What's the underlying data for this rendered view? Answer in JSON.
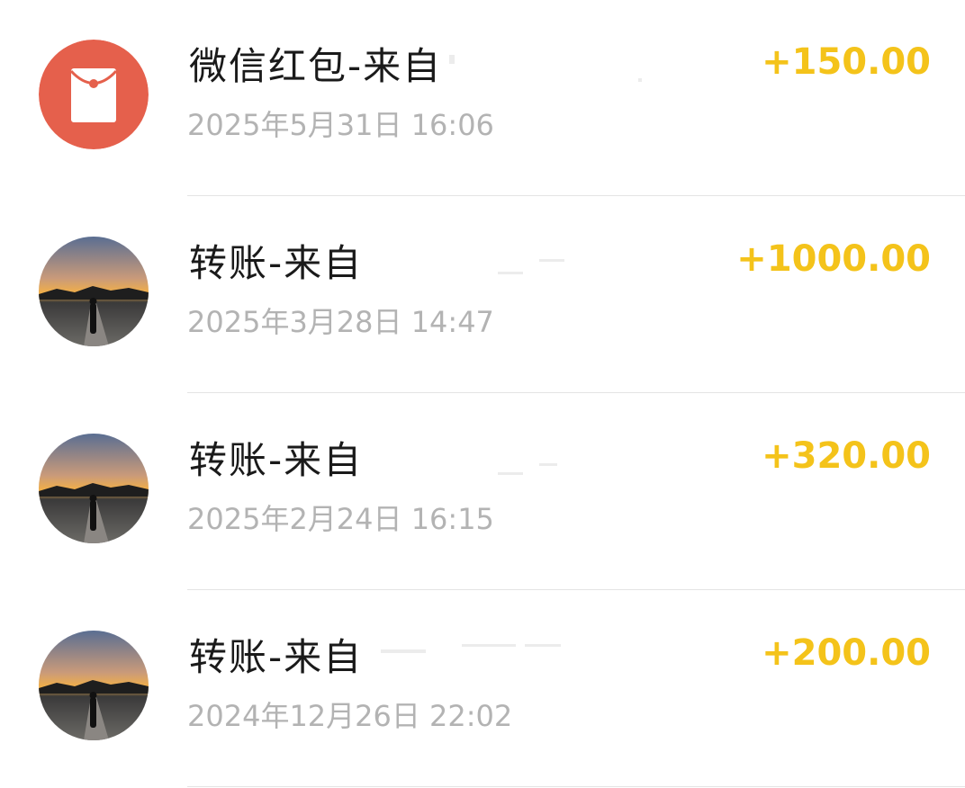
{
  "transactions": [
    {
      "icon": "red-envelope-icon",
      "title": "微信红包-来自",
      "datetime": "2025年5月31日 16:06",
      "amount": "+150.00"
    },
    {
      "icon": "avatar-sunset-photo",
      "title": "转账-来自",
      "datetime": "2025年3月28日 14:47",
      "amount": "+1000.00"
    },
    {
      "icon": "avatar-sunset-photo",
      "title": "转账-来自",
      "datetime": "2025年2月24日 16:15",
      "amount": "+320.00"
    },
    {
      "icon": "avatar-sunset-photo",
      "title": "转账-来自",
      "datetime": "2024年12月26日 22:02",
      "amount": "+200.00"
    }
  ],
  "colors": {
    "amount": "#f4c31a",
    "red_envelope": "#e5604c",
    "meta_text": "#b3b3b3",
    "divider": "#e4e4e4"
  }
}
